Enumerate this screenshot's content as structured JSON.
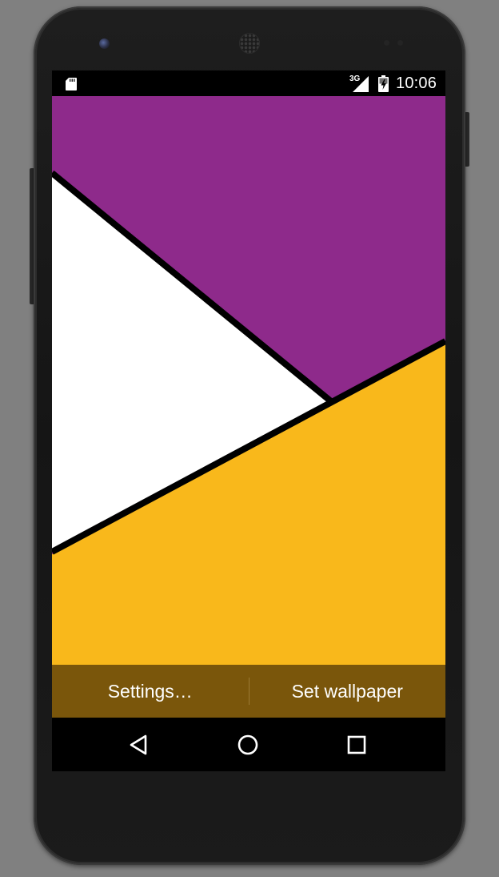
{
  "device": {
    "frame_color": "#161616",
    "background_color": "#808080"
  },
  "statusbar": {
    "network_type": "3G",
    "time": "10:06",
    "icons": [
      "sd-card-icon",
      "signal-3g-icon",
      "battery-charging-icon"
    ]
  },
  "wallpaper": {
    "colors": {
      "purple": "#8e2a8b",
      "white": "#ffffff",
      "yellow": "#f9b81b",
      "divider": "#000000"
    }
  },
  "actionbar": {
    "settings_label": "Settings…",
    "set_wallpaper_label": "Set wallpaper",
    "background": "#7a560b"
  },
  "navbar": {
    "icons": [
      "back-icon",
      "home-icon",
      "recents-icon"
    ]
  }
}
